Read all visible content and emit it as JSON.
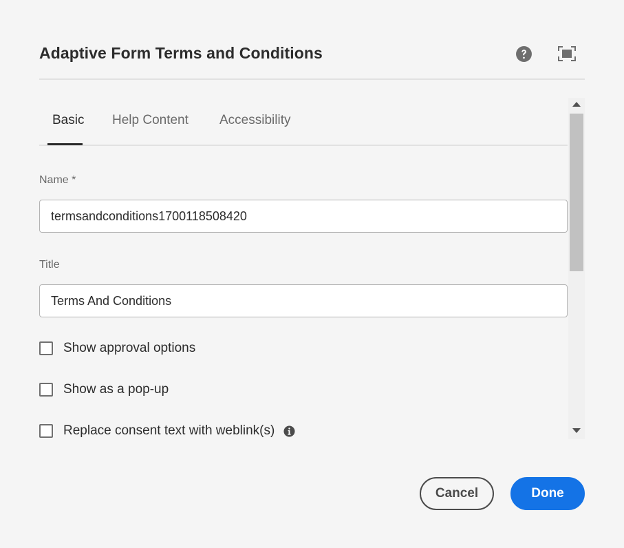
{
  "dialog": {
    "title": "Adaptive Form Terms and Conditions"
  },
  "tabs": [
    {
      "label": "Basic",
      "active": true
    },
    {
      "label": "Help Content",
      "active": false
    },
    {
      "label": "Accessibility",
      "active": false
    }
  ],
  "fields": {
    "name": {
      "label": "Name *",
      "value": "termsandconditions1700118508420"
    },
    "title": {
      "label": "Title",
      "value": "Terms And Conditions"
    }
  },
  "checkboxes": [
    {
      "label": "Show approval options",
      "checked": false
    },
    {
      "label": "Show as a pop-up",
      "checked": false
    },
    {
      "label": "Replace consent text with weblink(s)",
      "checked": false
    }
  ],
  "footer": {
    "cancel_label": "Cancel",
    "done_label": "Done"
  },
  "icons": {
    "help": "help-circle-icon",
    "fullscreen": "fullscreen-icon",
    "info": "info-icon"
  },
  "colors": {
    "accent": "#1473e6",
    "background": "#f5f5f5",
    "text": "#2c2c2c"
  }
}
